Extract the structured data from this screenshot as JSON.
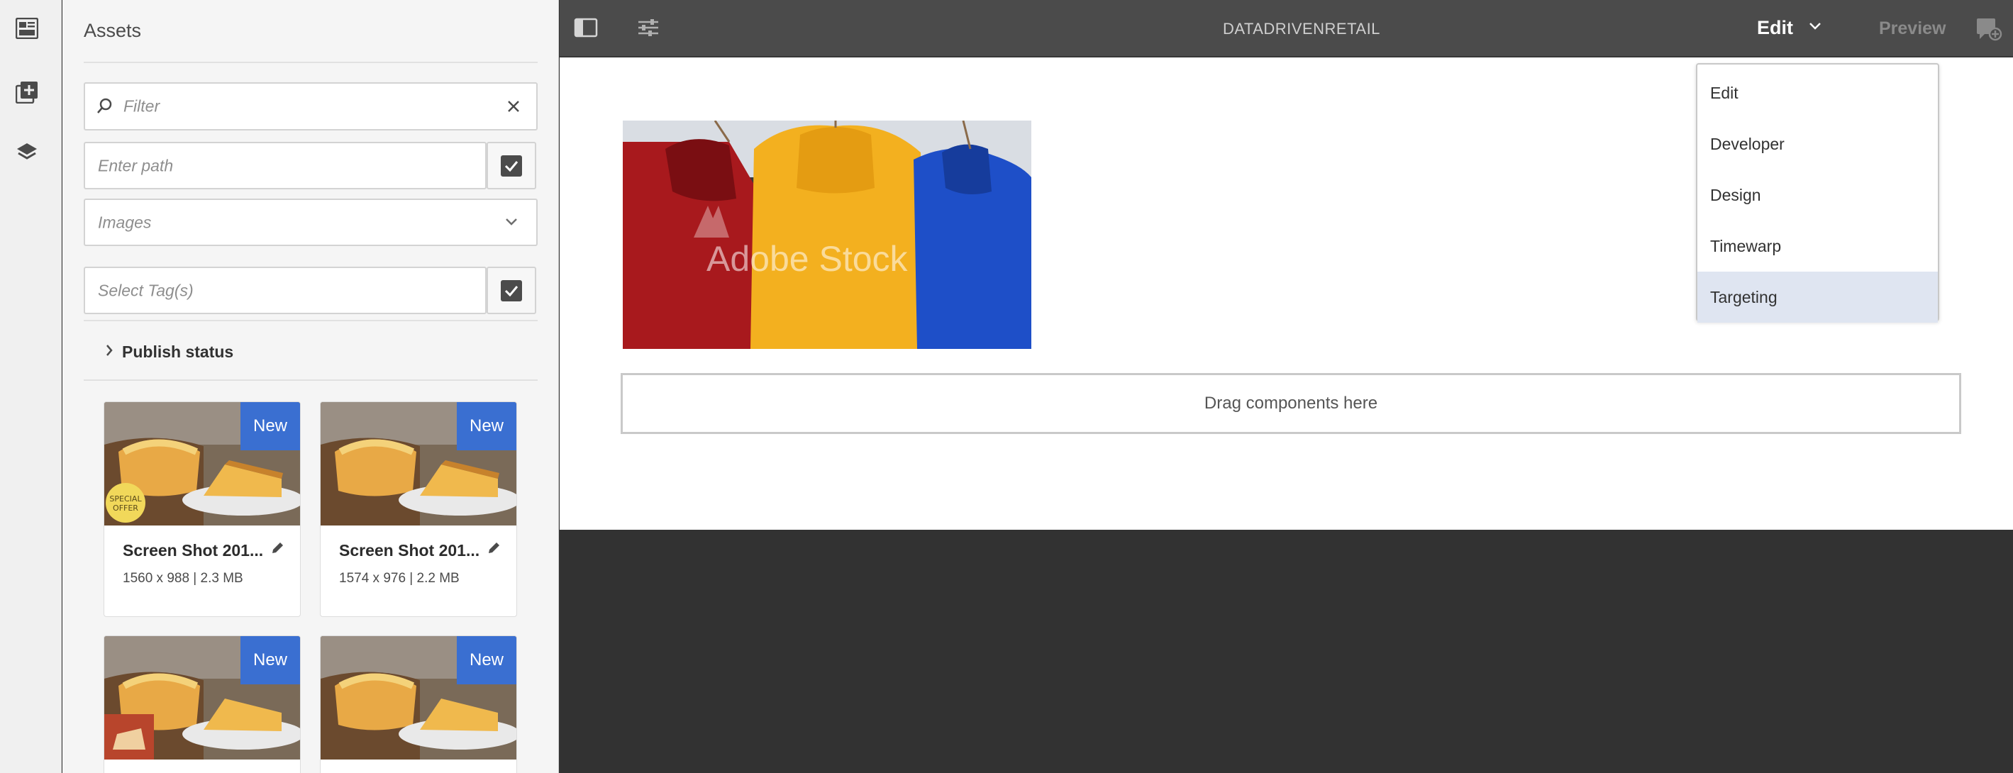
{
  "sidebar": {
    "title": "Assets",
    "filter_placeholder": "Filter",
    "path_placeholder": "Enter path",
    "type_value": "Images",
    "tags_placeholder": "Select Tag(s)",
    "publish_status": "Publish status",
    "assets": [
      {
        "badge": "New",
        "name": "Screen Shot 201...",
        "meta": "1560 x 988 | 2.3 MB"
      },
      {
        "badge": "New",
        "name": "Screen Shot 201...",
        "meta": "1574 x 976 | 2.2 MB"
      },
      {
        "badge": "New",
        "name": "",
        "meta": ""
      },
      {
        "badge": "New",
        "name": "",
        "meta": ""
      }
    ]
  },
  "topbar": {
    "page_title": "DATADRIVENRETAIL",
    "mode": "Edit",
    "preview": "Preview"
  },
  "canvas": {
    "watermark": "Adobe Stock",
    "dropzone_label": "Drag components here"
  },
  "mode_menu": {
    "items": [
      "Edit",
      "Developer",
      "Design",
      "Timewarp",
      "Targeting"
    ],
    "selected": "Targeting"
  },
  "colors": {
    "badge": "#3a6fd1",
    "topbar": "#4b4b4b",
    "workspace": "#323232",
    "menu_selected": "#dfe5f1"
  }
}
